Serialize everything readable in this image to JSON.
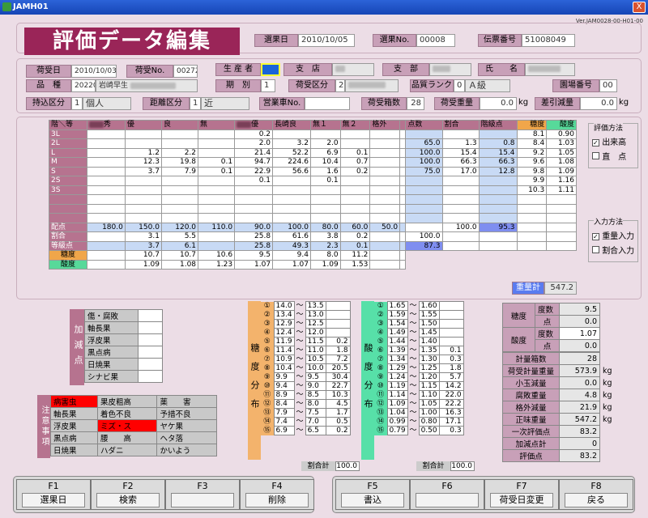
{
  "window": {
    "title": "JAMH01",
    "close": "X"
  },
  "version": "Ver.JAM0028-00-H01-00",
  "title": "評価データ編集",
  "header": {
    "sentaku_bi_label": "選果日",
    "sentaku_bi": "2010/10/05",
    "sentaku_no_label": "選果No.",
    "sentaku_no": "00008",
    "denpyo_label": "伝票番号",
    "denpyo": "51008049"
  },
  "info": {
    "niuke_bi_label": "荷受日",
    "niuke_bi": "2010/10/03",
    "niuke_no_label": "荷受No.",
    "niuke_no": "00272",
    "seisansha_label": "生 産 者",
    "shiten_label": "支　店",
    "shibu_label": "支　部",
    "shimei_label": "氏　　名",
    "hinshu_label": "品　種",
    "hinshu_code": "20220",
    "hinshu_name": "岩崎早生",
    "kibetsu_label": "期　別",
    "kibetsu": "1",
    "niuke_kubun_label": "荷受区分",
    "niuke_kubun": "2",
    "hinshitsu_label": "品質ランク",
    "hinshitsu_code": "0",
    "hinshitsu_name": "Ａ級",
    "enjo_label": "園場番号",
    "enjo": "00",
    "mochikomi_label": "持込区分",
    "mochikomi_code": "1",
    "mochikomi_name": "個人",
    "kyori_label": "距離区分",
    "kyori_code": "1",
    "kyori_name": "近",
    "eigyosha_label": "営業車No.",
    "eigyosha": "",
    "hako_label": "荷受箱数",
    "hako": "28",
    "juryo_label": "荷受重量",
    "juryo": "0.0",
    "juryo_unit": "kg",
    "sashihiki_label": "差引減量",
    "sashihiki": "0.0",
    "sashihiki_unit": "kg"
  },
  "grid": {
    "corner": "階＼等",
    "cols": [
      "秀",
      "優",
      "良",
      "無",
      "優",
      "長崎良",
      "無１",
      "無２",
      "格外",
      ""
    ],
    "tens": "点数",
    "wariai": "割合",
    "kaikyu": "階級点",
    "toudo": "糖度",
    "sando": "酸度",
    "rows": [
      {
        "label": "3L",
        "v": [
          "",
          "",
          "",
          "",
          "0.2",
          "",
          "",
          "",
          ""
        ],
        "tensu": "",
        "wari": "",
        "kai": "",
        "t": "8.1",
        "s": "0.90"
      },
      {
        "label": "2L",
        "v": [
          "",
          "",
          "",
          "",
          "2.0",
          "3.2",
          "2.0",
          "",
          ""
        ],
        "tensu": "65.0",
        "wari": "1.3",
        "kai": "0.8",
        "t": "8.4",
        "s": "1.03"
      },
      {
        "label": "L",
        "v": [
          "",
          "1.2",
          "2.2",
          "",
          "21.4",
          "52.2",
          "6.9",
          "0.1",
          ""
        ],
        "tensu": "100.0",
        "wari": "15.4",
        "kai": "15.4",
        "t": "9.2",
        "s": "1.05"
      },
      {
        "label": "M",
        "v": [
          "",
          "12.3",
          "19.8",
          "0.1",
          "94.7",
          "224.6",
          "10.4",
          "0.7",
          ""
        ],
        "tensu": "100.0",
        "wari": "66.3",
        "kai": "66.3",
        "t": "9.6",
        "s": "1.08"
      },
      {
        "label": "S",
        "v": [
          "",
          "3.7",
          "7.9",
          "0.1",
          "22.9",
          "56.6",
          "1.6",
          "0.2",
          ""
        ],
        "tensu": "75.0",
        "wari": "17.0",
        "kai": "12.8",
        "t": "9.8",
        "s": "1.09"
      },
      {
        "label": "2S",
        "v": [
          "",
          "",
          "",
          "",
          "0.1",
          "",
          "0.1",
          "",
          ""
        ],
        "tensu": "",
        "wari": "",
        "kai": "",
        "t": "9.9",
        "s": "1.16"
      },
      {
        "label": "3S",
        "v": [
          "",
          "",
          "",
          "",
          "",
          "",
          "",
          "",
          ""
        ],
        "tensu": "",
        "wari": "",
        "kai": "",
        "t": "10.3",
        "s": "1.11"
      },
      {
        "label": "",
        "v": [
          "",
          "",
          "",
          "",
          "",
          "",
          "",
          "",
          ""
        ],
        "tensu": "",
        "wari": "",
        "kai": "",
        "t": "",
        "s": ""
      },
      {
        "label": "",
        "v": [
          "",
          "",
          "",
          "",
          "",
          "",
          "",
          "",
          ""
        ],
        "tensu": "",
        "wari": "",
        "kai": "",
        "t": "",
        "s": ""
      },
      {
        "label": "",
        "v": [
          "",
          "",
          "",
          "",
          "",
          "",
          "",
          "",
          ""
        ],
        "tensu": "",
        "wari": "",
        "kai": "",
        "t": "",
        "s": ""
      }
    ],
    "tensu_row": {
      "label": "配点",
      "v": [
        "180.0",
        "150.0",
        "120.0",
        "110.0",
        "90.0",
        "100.0",
        "80.0",
        "60.0",
        "50.0"
      ],
      "wari": "100.0",
      "kai": "95.3"
    },
    "wari_row": {
      "label": "割合",
      "v": [
        "",
        "3.1",
        "5.5",
        "",
        "25.8",
        "61.6",
        "3.8",
        "0.2",
        ""
      ],
      "x": "100.0"
    },
    "kaikyu_row": {
      "label": "等級点",
      "v": [
        "",
        "3.7",
        "6.1",
        "",
        "25.8",
        "49.3",
        "2.3",
        "0.1",
        ""
      ],
      "x": "87.3"
    },
    "toudo_row": {
      "label": "糖度",
      "v": [
        "",
        "10.7",
        "10.7",
        "10.6",
        "9.5",
        "9.4",
        "8.0",
        "11.2",
        ""
      ]
    },
    "sando_row": {
      "label": "酸度",
      "v": [
        "",
        "1.09",
        "1.08",
        "1.23",
        "1.07",
        "1.07",
        "1.09",
        "1.53",
        ""
      ]
    },
    "juryokei_label": "重量計",
    "juryokei": "547.2"
  },
  "hyoka": {
    "title": "評価方法",
    "opt1": "出来高",
    "opt2": "直　点"
  },
  "nyuryoku": {
    "title": "入力方法",
    "opt1": "重量入力",
    "opt2": "割合入力"
  },
  "kagen": {
    "side": "加減点",
    "items": [
      "傷・腐敗",
      "軸長果",
      "浮皮果",
      "黒点病",
      "日焼果",
      "シナビ果"
    ]
  },
  "chui": {
    "side": "注意事項",
    "rows": [
      [
        "病害虫",
        "果皮粗高",
        "薬　　害"
      ],
      [
        "軸長果",
        "着色不良",
        "予措不良"
      ],
      [
        "浮皮果",
        "ミズ・ス",
        "ヤケ果"
      ],
      [
        "黒点病",
        "腰　　高",
        "ヘタ落"
      ],
      [
        "日焼果",
        "ハダニ",
        "かいよう"
      ]
    ]
  },
  "toudo_dist": {
    "side": "糖度分布",
    "range": [
      [
        "14.0",
        "13.5",
        ""
      ],
      [
        "13.4",
        "13.0",
        ""
      ],
      [
        "12.9",
        "12.5",
        ""
      ],
      [
        "12.4",
        "12.0",
        ""
      ],
      [
        "11.9",
        "11.5",
        "0.2"
      ],
      [
        "11.4",
        "11.0",
        "1.8"
      ],
      [
        "10.9",
        "10.5",
        "7.2"
      ],
      [
        "10.4",
        "10.0",
        "20.5"
      ],
      [
        "9.9",
        "9.5",
        "30.4"
      ],
      [
        "9.4",
        "9.0",
        "22.7"
      ],
      [
        "8.9",
        "8.5",
        "10.3"
      ],
      [
        "8.4",
        "8.0",
        "4.5"
      ],
      [
        "7.9",
        "7.5",
        "1.7"
      ],
      [
        "7.4",
        "7.0",
        "0.5"
      ],
      [
        "6.9",
        "6.5",
        "0.2"
      ]
    ],
    "total_label": "割合計",
    "total": "100.0"
  },
  "sando_dist": {
    "side": "酸度分布",
    "range": [
      [
        "1.65",
        "1.60",
        ""
      ],
      [
        "1.59",
        "1.55",
        ""
      ],
      [
        "1.54",
        "1.50",
        ""
      ],
      [
        "1.49",
        "1.45",
        ""
      ],
      [
        "1.44",
        "1.40",
        ""
      ],
      [
        "1.39",
        "1.35",
        "0.1"
      ],
      [
        "1.34",
        "1.30",
        "0.3"
      ],
      [
        "1.29",
        "1.25",
        "1.8"
      ],
      [
        "1.24",
        "1.20",
        "5.7"
      ],
      [
        "1.19",
        "1.15",
        "14.2"
      ],
      [
        "1.14",
        "1.10",
        "22.0"
      ],
      [
        "1.09",
        "1.05",
        "22.2"
      ],
      [
        "1.04",
        "1.00",
        "16.3"
      ],
      [
        "0.99",
        "0.80",
        "17.1"
      ],
      [
        "0.79",
        "0.50",
        "0.3"
      ]
    ],
    "total_label": "割合計",
    "total": "100.0"
  },
  "circled": [
    "①",
    "②",
    "③",
    "④",
    "⑤",
    "⑥",
    "⑦",
    "⑧",
    "⑨",
    "⑩",
    "⑪",
    "⑫",
    "⑬",
    "⑭",
    "⑮"
  ],
  "summary": {
    "toudo_label": "糖度",
    "toudo_do_label": "度数",
    "toudo_do": "9.5",
    "toudo_ten_label": "点",
    "toudo_ten": "0.0",
    "sando_label": "酸度",
    "sando_do_label": "度数",
    "sando_do": "1.07",
    "sando_ten_label": "点",
    "sando_ten": "0.0",
    "rows": [
      [
        "計量箱数",
        "28",
        ""
      ],
      [
        "荷受計量重量",
        "573.9",
        "kg"
      ],
      [
        "小玉減量",
        "0.0",
        "kg"
      ],
      [
        "腐敗重量",
        "4.8",
        "kg"
      ],
      [
        "格外減量",
        "21.9",
        "kg"
      ],
      [
        "正味重量",
        "547.2",
        "kg"
      ],
      [
        "一次評価点",
        "83.2",
        ""
      ],
      [
        "加減点計",
        "0",
        ""
      ],
      [
        "評価点",
        "83.2",
        ""
      ]
    ]
  },
  "fkeys": [
    {
      "n": "F1",
      "t": "選果日"
    },
    {
      "n": "F2",
      "t": "検索"
    },
    {
      "n": "F3",
      "t": ""
    },
    {
      "n": "F4",
      "t": "削除"
    },
    {
      "n": "F5",
      "t": "書込"
    },
    {
      "n": "F6",
      "t": ""
    },
    {
      "n": "F7",
      "t": "荷受日変更"
    },
    {
      "n": "F8",
      "t": "戻る"
    }
  ]
}
